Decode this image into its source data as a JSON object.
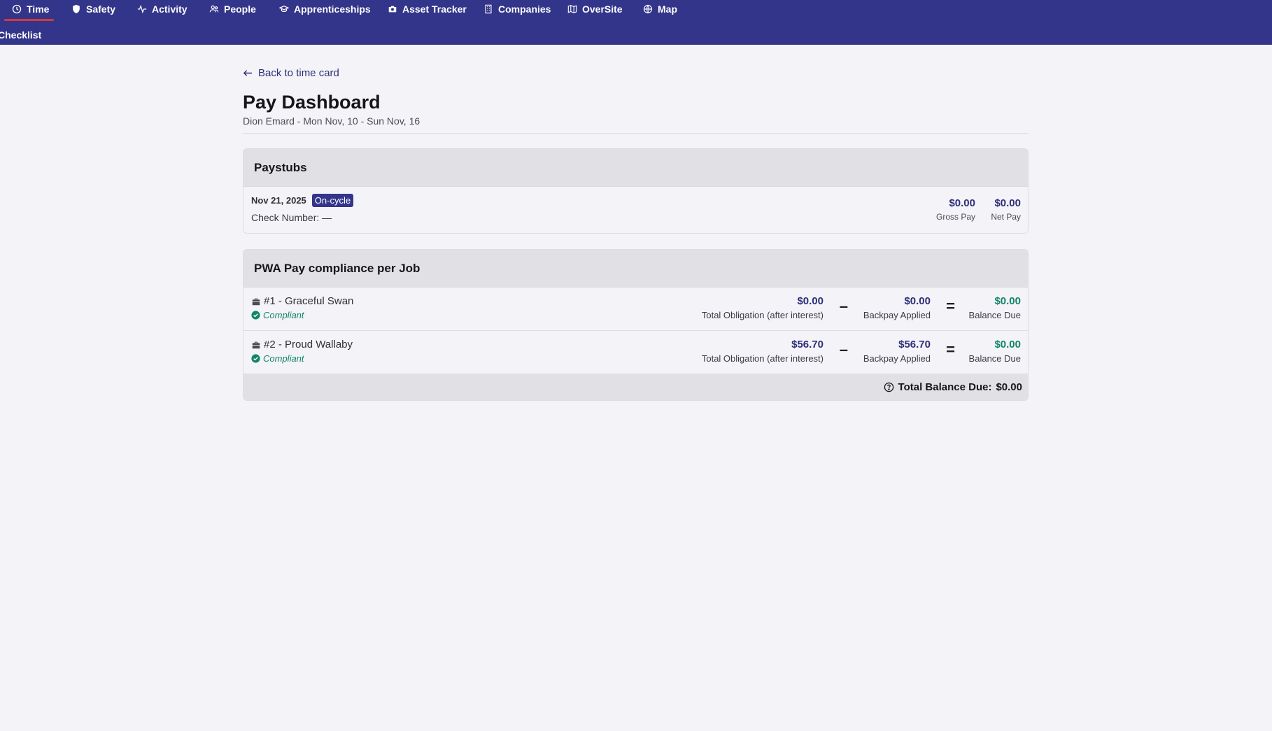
{
  "nav": {
    "items": [
      {
        "label": "Time",
        "icon": "clock-icon"
      },
      {
        "label": "Safety",
        "icon": "shield-icon"
      },
      {
        "label": "Activity",
        "icon": "activity-icon"
      },
      {
        "label": "People",
        "icon": "people-icon"
      },
      {
        "label": "Apprenticeships",
        "icon": "graduation-cap-icon"
      },
      {
        "label": "Asset Tracker",
        "icon": "camera-icon"
      },
      {
        "label": "Companies",
        "icon": "building-icon"
      },
      {
        "label": "OverSite",
        "icon": "map-icon"
      },
      {
        "label": "Map",
        "icon": "globe-icon"
      }
    ],
    "active": "Time",
    "sub_item": "Checklist"
  },
  "back_link": "Back to time card",
  "page": {
    "title": "Pay Dashboard",
    "subtitle": "Dion Emard - Mon Nov, 10 - Sun Nov, 16"
  },
  "paystubs": {
    "header": "Paystubs",
    "items": [
      {
        "date": "Nov 21, 2025",
        "badge": "On-cycle",
        "check_number": "Check Number: —",
        "gross_pay": "$0.00",
        "gross_pay_label": "Gross Pay",
        "net_pay": "$0.00",
        "net_pay_label": "Net Pay"
      }
    ]
  },
  "compliance": {
    "header": "PWA Pay compliance per Job",
    "jobs": [
      {
        "name": "#1 - Graceful Swan",
        "status": "Compliant",
        "total_obligation": "$0.00",
        "total_obligation_label": "Total Obligation (after interest)",
        "backpay": "$0.00",
        "backpay_label": "Backpay Applied",
        "balance": "$0.00",
        "balance_label": "Balance Due"
      },
      {
        "name": "#2 - Proud Wallaby",
        "status": "Compliant",
        "total_obligation": "$56.70",
        "total_obligation_label": "Total Obligation (after interest)",
        "backpay": "$56.70",
        "backpay_label": "Backpay Applied",
        "balance": "$0.00",
        "balance_label": "Balance Due"
      }
    ],
    "operators": {
      "minus": "–",
      "equals": "="
    },
    "total_label": "Total Balance Due:",
    "total_value": "$0.00"
  },
  "colors": {
    "nav_bg": "#33358a",
    "accent": "#2d2f7a",
    "active_underline": "#d43a3a",
    "compliant_green": "#11856a"
  }
}
